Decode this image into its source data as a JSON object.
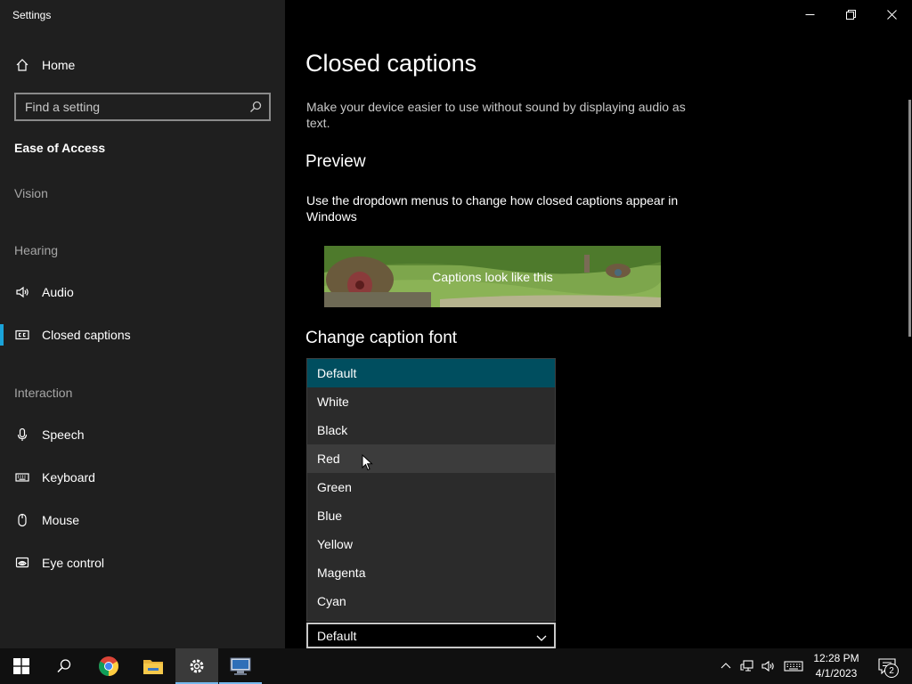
{
  "window": {
    "title": "Settings"
  },
  "sidebar": {
    "home_label": "Home",
    "search_placeholder": "Find a setting",
    "section_title": "Ease of Access",
    "groups": {
      "vision": "Vision",
      "hearing": "Hearing",
      "interaction": "Interaction"
    },
    "items": {
      "audio": "Audio",
      "closed_captions": "Closed captions",
      "speech": "Speech",
      "keyboard": "Keyboard",
      "mouse": "Mouse",
      "eye_control": "Eye control"
    },
    "selected_item": "Closed captions",
    "accent_color": "#1aa3d9"
  },
  "main": {
    "title": "Closed captions",
    "description": "Make your device easier to use without sound by displaying audio as text.",
    "preview_heading": "Preview",
    "preview_description": "Use the dropdown menus to change how closed captions appear in Windows",
    "preview_caption": "Captions look like this",
    "font_heading": "Change caption font",
    "color_dropdown": {
      "options": [
        "Default",
        "White",
        "Black",
        "Red",
        "Green",
        "Blue",
        "Yellow",
        "Magenta",
        "Cyan"
      ],
      "selected": "Default",
      "hovered": "Red",
      "current_value": "Default"
    }
  },
  "taskbar": {
    "clock_time": "12:28 PM",
    "clock_date": "4/1/2023",
    "notification_count": "2"
  }
}
